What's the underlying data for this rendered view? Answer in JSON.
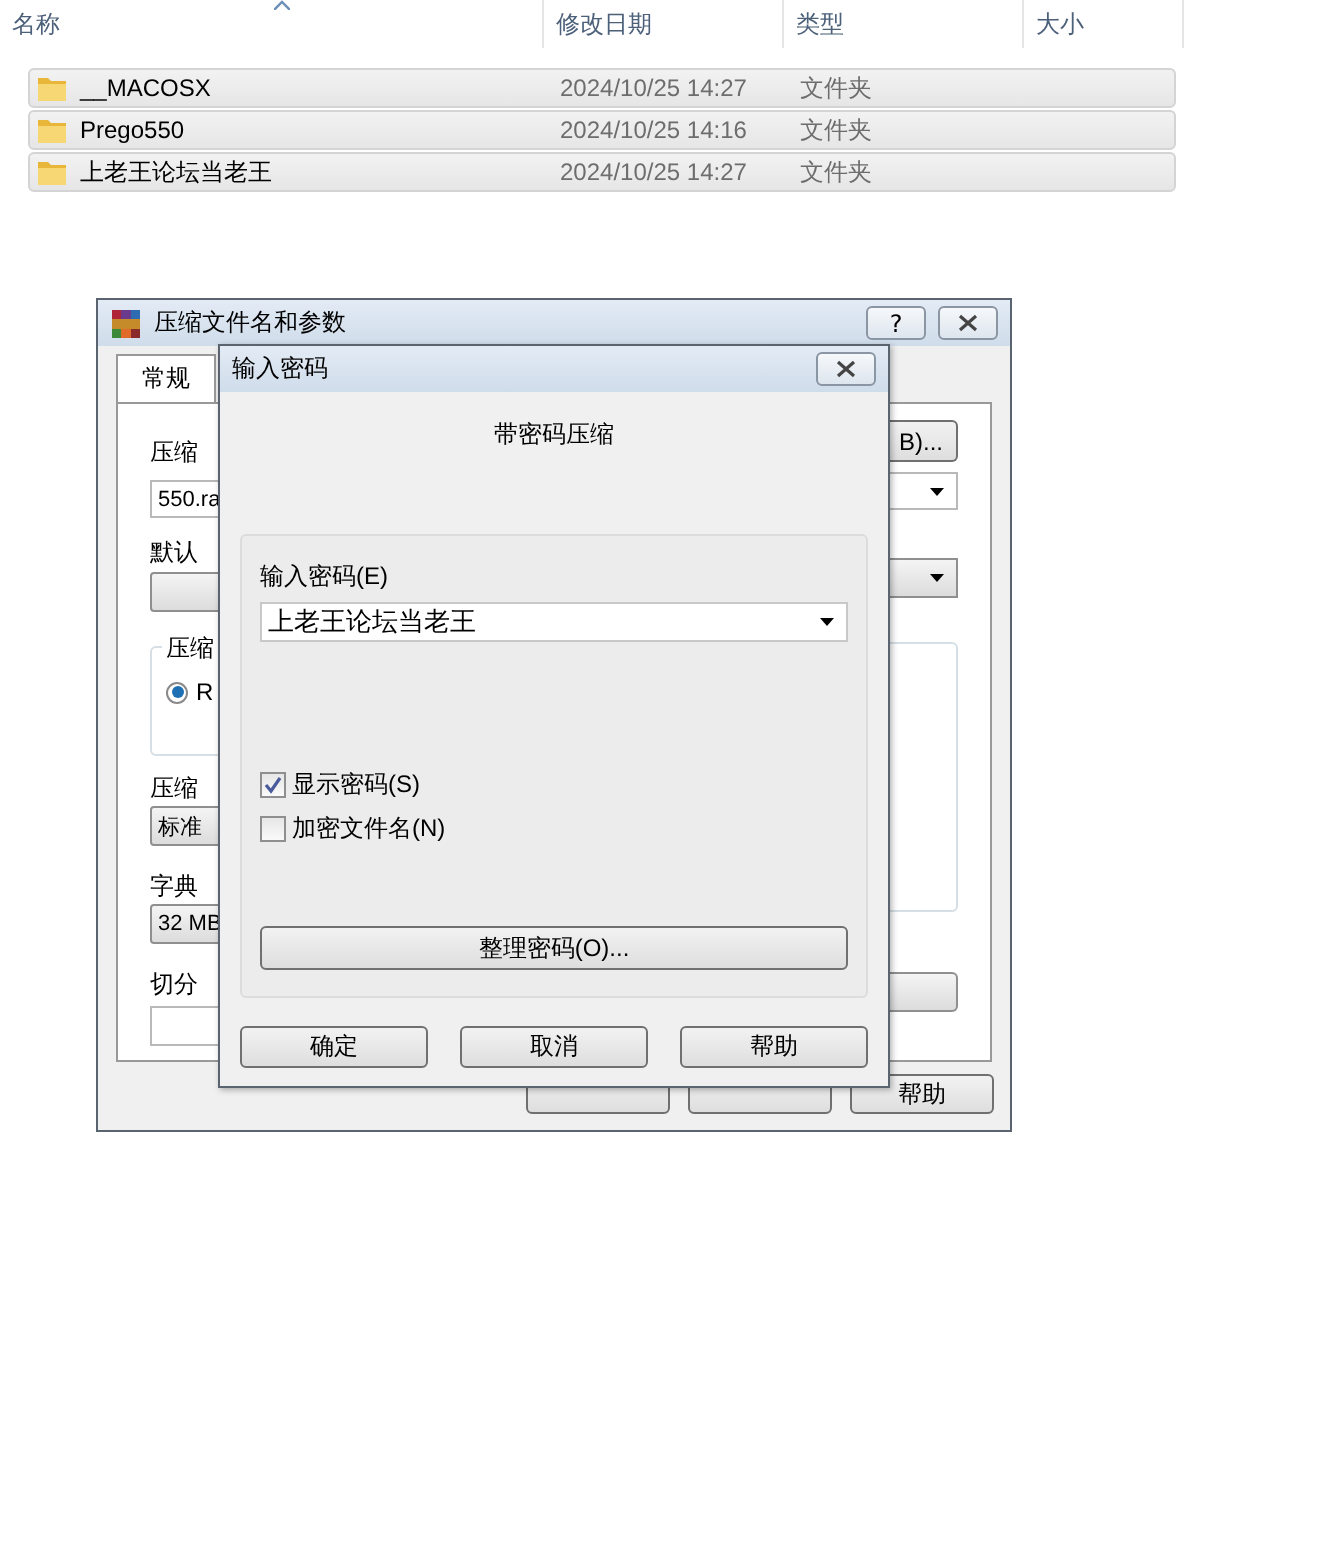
{
  "file_list": {
    "columns": [
      "名称",
      "修改日期",
      "类型",
      "大小"
    ],
    "rows": [
      {
        "name": "__MACOSX",
        "modified": "2024/10/25 14:27",
        "type": "文件夹",
        "selected": true
      },
      {
        "name": "Prego550",
        "modified": "2024/10/25 14:16",
        "type": "文件夹",
        "selected": true
      },
      {
        "name": "上老王论坛当老王",
        "modified": "2024/10/25 14:27",
        "type": "文件夹",
        "selected": true
      }
    ]
  },
  "archive_dialog": {
    "title": "压缩文件名和参数",
    "help_button": "?",
    "tabs": [
      {
        "label": "常规",
        "selected": true
      }
    ],
    "archive_name_label": "压缩",
    "archive_name_value": "550.ra",
    "browse_button": "B)...",
    "profile_label": "默认",
    "format_group_label": "压缩",
    "format_options": [
      {
        "label": "R",
        "selected": true
      }
    ],
    "method_label": "压缩",
    "method_value": "标准",
    "dictionary_label": "字典",
    "dictionary_value": "32 MB",
    "split_label": "切分",
    "buttons": [
      "帮助"
    ]
  },
  "password_dialog": {
    "title": "输入密码",
    "heading": "带密码压缩",
    "password_label": "输入密码(E)",
    "password_value": "上老王论坛当老王",
    "options": [
      {
        "label": "显示密码(S)",
        "checked": true
      },
      {
        "label": "加密文件名(N)",
        "checked": false
      }
    ],
    "organize_button": "整理密码(O)...",
    "buttons": [
      "确定",
      "取消",
      "帮助"
    ]
  }
}
